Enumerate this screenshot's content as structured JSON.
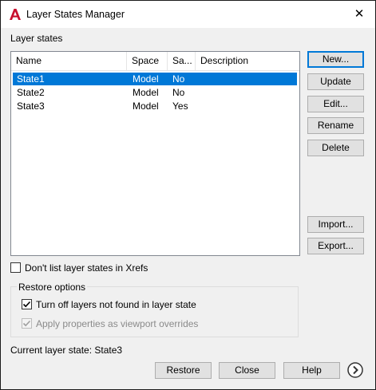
{
  "window": {
    "title": "Layer States Manager",
    "close_glyph": "✕"
  },
  "section_label": "Layer states",
  "table": {
    "columns": [
      "Name",
      "Space",
      "Sa...",
      "Description"
    ],
    "rows": [
      {
        "name": "State1",
        "space": "Model",
        "saved": "No",
        "description": "",
        "selected": true
      },
      {
        "name": "State2",
        "space": "Model",
        "saved": "No",
        "description": "",
        "selected": false
      },
      {
        "name": "State3",
        "space": "Model",
        "saved": "Yes",
        "description": "",
        "selected": false
      }
    ]
  },
  "side_buttons": {
    "new": "New...",
    "update": "Update",
    "edit": "Edit...",
    "rename": "Rename",
    "delete": "Delete",
    "import": "Import...",
    "export": "Export..."
  },
  "dont_list_xrefs": {
    "label": "Don't list layer states in Xrefs",
    "checked": false
  },
  "restore_options": {
    "legend": "Restore options",
    "turn_off": {
      "label": "Turn off layers not found in layer state",
      "checked": true
    },
    "apply_props": {
      "label": "Apply properties as viewport overrides",
      "checked": true,
      "enabled": false
    }
  },
  "current_state": "Current layer state: State3",
  "bottom_buttons": {
    "restore": "Restore",
    "close": "Close",
    "help": "Help"
  },
  "colors": {
    "selection": "#0078d7",
    "accent_icon": "#c8102e",
    "dialog_bg": "#f0f0f0"
  },
  "icons": {
    "app": "autocad-a-icon",
    "expand": "chevron-right-circle-icon"
  }
}
